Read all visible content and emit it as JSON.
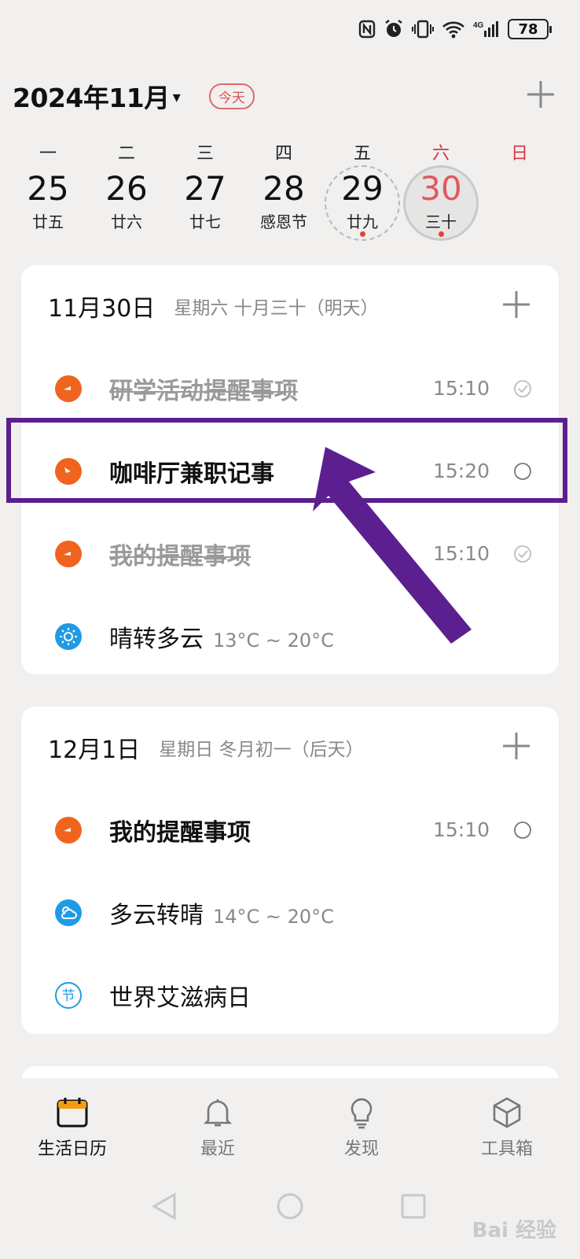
{
  "status_bar": {
    "battery": "78",
    "network": "4G"
  },
  "header": {
    "month": "2024年11月",
    "caret": "▾",
    "today": "今天"
  },
  "week": [
    {
      "weekday": "一",
      "date": "25",
      "lunar": "廿五"
    },
    {
      "weekday": "二",
      "date": "26",
      "lunar": "廿六"
    },
    {
      "weekday": "三",
      "date": "27",
      "lunar": "廿七"
    },
    {
      "weekday": "四",
      "date": "28",
      "lunar": "感恩节"
    },
    {
      "weekday": "五",
      "date": "29",
      "lunar": "廿九"
    },
    {
      "weekday": "六",
      "date": "30",
      "lunar": "三十"
    },
    {
      "weekday": "日",
      "date": "",
      "lunar": ""
    }
  ],
  "cards": [
    {
      "date": "11月30日",
      "meta": "星期六   十月三十（明天）",
      "rows": [
        {
          "title": "研学活动提醒事项",
          "time": "15:10",
          "status": "done"
        },
        {
          "title": "咖啡厅兼职记事",
          "time": "15:20",
          "status": "pending"
        },
        {
          "title": "我的提醒事项",
          "time": "15:10",
          "status": "done"
        },
        {
          "title": "晴转多云",
          "temp": "13°C ~ 20°C"
        }
      ]
    },
    {
      "date": "12月1日",
      "meta": "星期日   冬月初一（后天）",
      "rows": [
        {
          "title": "我的提醒事项",
          "time": "15:10",
          "status": "pending"
        },
        {
          "title": "多云转晴",
          "temp": "14°C ~ 20°C"
        },
        {
          "title": "世界艾滋病日",
          "festival_glyph": "节"
        }
      ]
    }
  ],
  "bottom_nav": [
    {
      "label": "生活日历",
      "icon": "calendar-icon",
      "active": true
    },
    {
      "label": "最近",
      "icon": "bell-icon",
      "active": false
    },
    {
      "label": "发现",
      "icon": "bulb-icon",
      "active": false
    },
    {
      "label": "工具箱",
      "icon": "cube-icon",
      "active": false
    }
  ],
  "watermark": "Bai 经验",
  "colors": {
    "accent_red": "#d9343c",
    "reminder_orange": "#f0641e",
    "weather_blue": "#1f9be6",
    "highlight_purple": "#5b1f8f"
  }
}
